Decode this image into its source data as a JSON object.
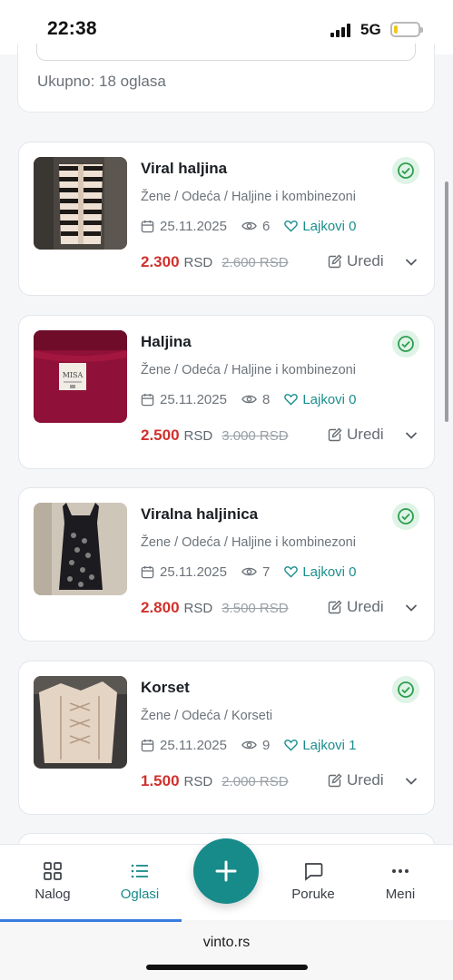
{
  "status": {
    "time": "22:38",
    "network": "5G"
  },
  "summary": {
    "total_text": "Ukupno: 18 oglasa"
  },
  "listings": [
    {
      "title": "Viral haljina",
      "category": "Žene / Odeća / Haljine i kombinezoni",
      "date": "25.11.2025",
      "views": "6",
      "likes": "Lajkovi 0",
      "price": "2.300",
      "currency": "RSD",
      "old_price": "2.600 RSD",
      "edit_label": "Uredi"
    },
    {
      "title": "Haljina",
      "category": "Žene / Odeća / Haljine i kombinezoni",
      "date": "25.11.2025",
      "views": "8",
      "likes": "Lajkovi 0",
      "price": "2.500",
      "currency": "RSD",
      "old_price": "3.000 RSD",
      "edit_label": "Uredi"
    },
    {
      "title": "Viralna haljinica",
      "category": "Žene / Odeća / Haljine i kombinezoni",
      "date": "25.11.2025",
      "views": "7",
      "likes": "Lajkovi 0",
      "price": "2.800",
      "currency": "RSD",
      "old_price": "3.500 RSD",
      "edit_label": "Uredi"
    },
    {
      "title": "Korset",
      "category": "Žene / Odeća / Korseti",
      "date": "25.11.2025",
      "views": "9",
      "likes": "Lajkovi 1",
      "price": "1.500",
      "currency": "RSD",
      "old_price": "2.000 RSD",
      "edit_label": "Uredi"
    }
  ],
  "nav": {
    "items": [
      {
        "label": "Nalog",
        "icon": "grid-icon"
      },
      {
        "label": "Oglasi",
        "icon": "list-icon",
        "active": true
      },
      {
        "label": "Poruke",
        "icon": "chat-icon"
      },
      {
        "label": "Meni",
        "icon": "dots-icon"
      }
    ],
    "fab_icon": "plus-icon"
  },
  "browser": {
    "url": "vinto.rs"
  },
  "colors": {
    "accent": "#178a8a",
    "price": "#d0312d",
    "verified_bg": "#dff3e6",
    "verified_check": "#2e9e4f"
  }
}
